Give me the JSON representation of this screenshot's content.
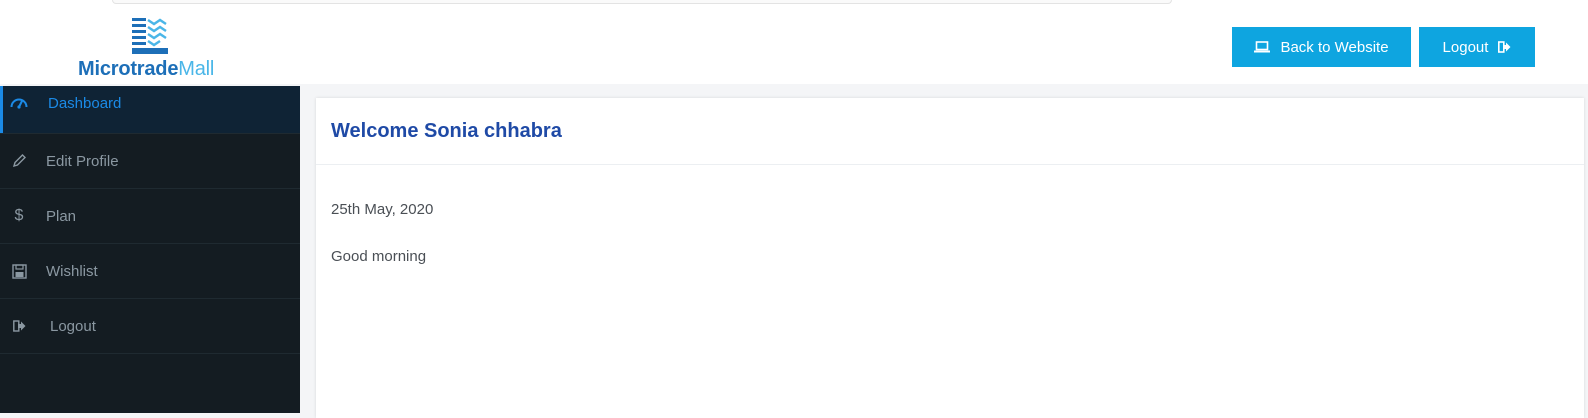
{
  "brand": {
    "name_part1": "Microtrade",
    "name_part2": "Mall",
    "color_primary": "#1d6fb8",
    "color_secondary": "#4ab6e8"
  },
  "header": {
    "back_label": "Back to Website",
    "back_icon": "laptop-icon",
    "logout_label": "Logout",
    "logout_icon": "sign-out-icon",
    "button_color": "#0ea5e0"
  },
  "sidebar": {
    "items": [
      {
        "label": "Dashboard",
        "icon": "dashboard-gauge-icon",
        "active": true
      },
      {
        "label": "Edit Profile",
        "icon": "pencil-icon",
        "active": false
      },
      {
        "label": "Plan",
        "icon": "dollar-icon",
        "active": false
      },
      {
        "label": "Wishlist",
        "icon": "floppy-disk-icon",
        "active": false
      },
      {
        "label": "Logout",
        "icon": "sign-out-icon",
        "active": false
      }
    ],
    "background": "#141c22",
    "active_color": "#1b8ae6"
  },
  "main": {
    "welcome": "Welcome Sonia chhabra",
    "date": "25th May, 2020",
    "greeting": "Good morning",
    "title_color": "#1f4aa6"
  }
}
